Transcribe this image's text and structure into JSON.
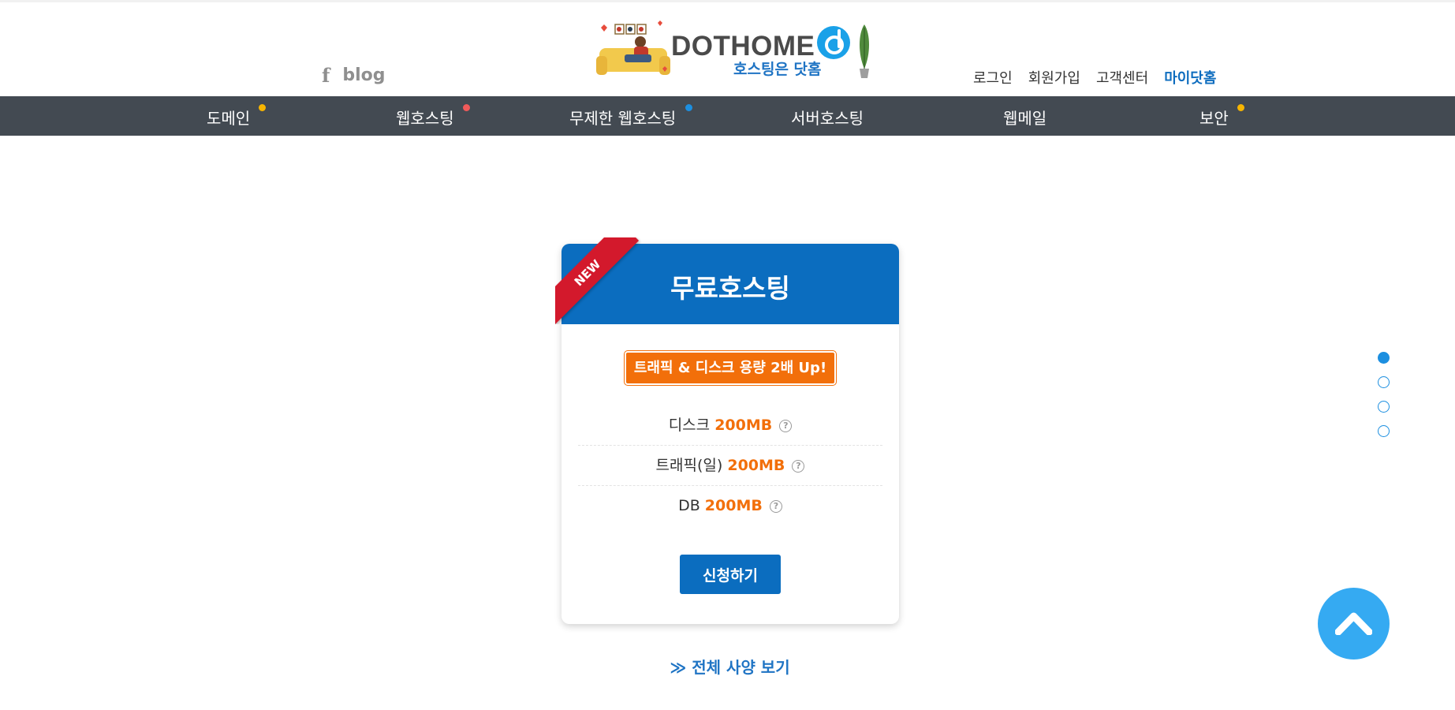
{
  "header": {
    "social": {
      "facebook_icon": "facebook-icon",
      "blog_label": "blog"
    },
    "logo": {
      "name": "DOTHOME",
      "tagline": "호스팅은 닷홈",
      "mark": "d"
    },
    "user_menu": {
      "login": "로그인",
      "signup": "회원가입",
      "support": "고객센터",
      "mydothome": "마이닷홈"
    }
  },
  "nav": {
    "items": [
      {
        "label": "도메인",
        "dot_color": "#f7b500"
      },
      {
        "label": "웹호스팅",
        "dot_color": "#f05a5a"
      },
      {
        "label": "무제한 웹호스팅",
        "dot_color": "#1c8fe0"
      },
      {
        "label": "서버호스팅",
        "dot_color": ""
      },
      {
        "label": "웹메일",
        "dot_color": ""
      },
      {
        "label": "보안",
        "dot_color": "#f7b500"
      }
    ]
  },
  "card": {
    "ribbon": "NEW",
    "title": "무료호스팅",
    "badge": "트래픽 & 디스크 용량 2배 Up!",
    "specs": [
      {
        "label": "디스크",
        "value": "200MB"
      },
      {
        "label": "트래픽(일)",
        "value": "200MB"
      },
      {
        "label": "DB",
        "value": "200MB"
      }
    ],
    "apply_label": "신청하기"
  },
  "view_all": "≫ 전체 사양 보기",
  "pager": {
    "count": 4,
    "active_index": 0
  },
  "colors": {
    "nav_bg": "#434a52",
    "brand_blue": "#0b6dbf",
    "accent_orange": "#f26f0a",
    "ribbon_red": "#d3192c",
    "top_button": "#35aaf2"
  }
}
